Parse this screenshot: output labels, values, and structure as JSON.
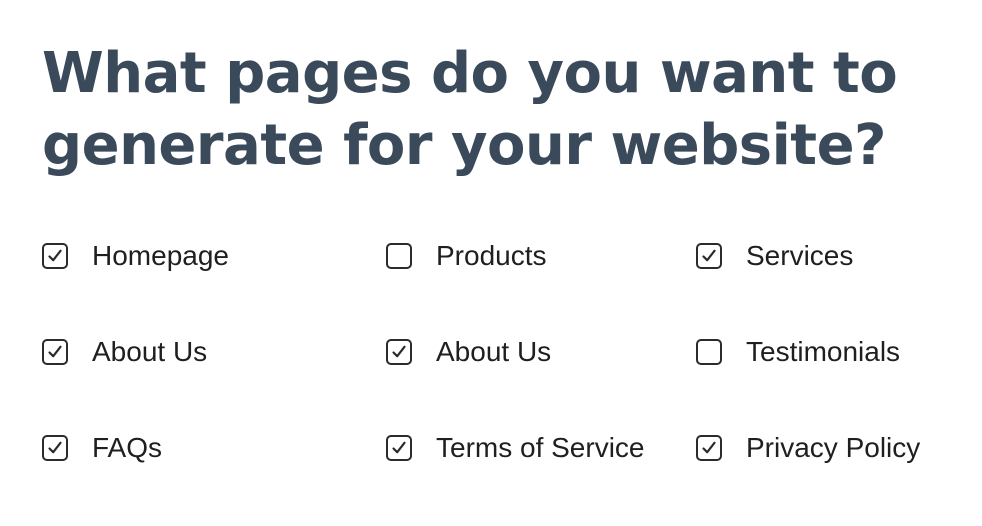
{
  "title": "What pages do you want to generate for your website?",
  "options": [
    {
      "label": "Homepage",
      "checked": true
    },
    {
      "label": "Products",
      "checked": false
    },
    {
      "label": "Services",
      "checked": true
    },
    {
      "label": "About Us",
      "checked": true
    },
    {
      "label": "About Us",
      "checked": true
    },
    {
      "label": "Testimonials",
      "checked": false
    },
    {
      "label": "FAQs",
      "checked": true
    },
    {
      "label": "Terms of Service",
      "checked": true
    },
    {
      "label": "Privacy Policy",
      "checked": true
    }
  ],
  "colors": {
    "title": "#3a4a5a",
    "checkbox_border": "#2b2b2b",
    "label": "#1f1f1f"
  },
  "icons": {
    "checked": "checkmark-icon"
  }
}
